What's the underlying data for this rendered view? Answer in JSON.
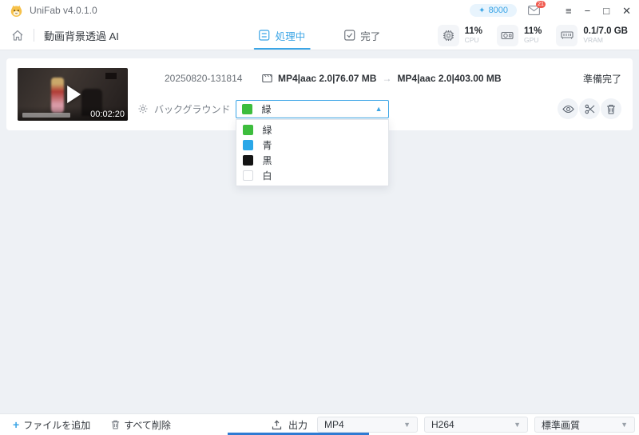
{
  "titlebar": {
    "app_title": "UniFab v4.0.1.0",
    "credits": "8000",
    "credits_star": "✦",
    "mail_badge": "21",
    "window": {
      "menu": "≡",
      "minimize": "−",
      "maximize": "□",
      "close": "✕"
    }
  },
  "navbar": {
    "page_title": "動画背景透過 AI",
    "tabs": [
      {
        "label": "処理中",
        "active": true
      },
      {
        "label": "完了",
        "active": false
      }
    ],
    "stats": [
      {
        "value": "11%",
        "label": "CPU"
      },
      {
        "value": "11%",
        "label": "GPU"
      },
      {
        "value": "0.1/7.0 GB",
        "label": "VRAM"
      }
    ]
  },
  "task": {
    "filename": "20250820-131814",
    "source_format": "MP4|aac 2.0|76.07 MB",
    "arrow": "→",
    "output_format": "MP4|aac 2.0|403.00 MB",
    "status": "準備完了",
    "duration": "00:02:20",
    "background_label": "バックグラウンド",
    "background_selected": {
      "label": "緑",
      "color": "#3dbd3d"
    },
    "chevron_up": "▲",
    "background_options": [
      {
        "label": "緑",
        "color": "#3dbd3d"
      },
      {
        "label": "青",
        "color": "#2aa7e8"
      },
      {
        "label": "黒",
        "color": "#141414"
      },
      {
        "label": "白",
        "color": "#ffffff"
      }
    ]
  },
  "footer": {
    "plus": "+",
    "add_files": "ファイルを追加",
    "delete_all": "すべて削除",
    "output_label": "出力",
    "format_value": "MP4",
    "codec_value": "H264",
    "quality_value": "標準画質",
    "chevron_down": "▼"
  },
  "colors": {
    "accent": "#3ba5e6",
    "badge_red": "#f05b50",
    "background": "#eef1f5"
  }
}
